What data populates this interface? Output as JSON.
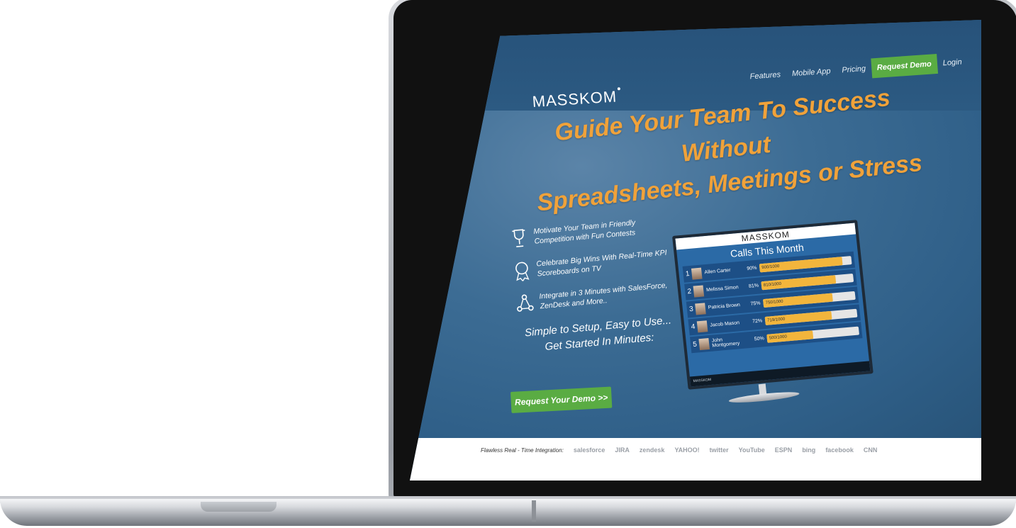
{
  "nav": {
    "brand": "MASSKOM",
    "items": [
      {
        "label": "Features",
        "cta": false
      },
      {
        "label": "Mobile App",
        "cta": false
      },
      {
        "label": "Pricing",
        "cta": false
      },
      {
        "label": "Request Demo",
        "cta": true
      },
      {
        "label": "Login",
        "cta": false
      }
    ]
  },
  "hero": {
    "headline_line1": "Guide Your Team To Success Without",
    "headline_line2": "Spreadsheets, Meetings or Stress",
    "features": [
      {
        "icon": "trophy-icon",
        "line1": "Motivate Your Team in Friendly",
        "line2": "Competition with Fun Contests"
      },
      {
        "icon": "award-ribbon-icon",
        "line1": "Celebrate Big Wins With Real-Time KPI",
        "line2": "Scoreboards on TV"
      },
      {
        "icon": "integration-network-icon",
        "line1": "Integrate in 3 Minutes with SalesForce,",
        "line2": "ZenDesk and More.."
      }
    ],
    "tagline_line1": "Simple to Setup, Easy to Use...",
    "tagline_line2": "Get Started In Minutes:",
    "demo_button": "Request Your Demo >>"
  },
  "leaderboard": {
    "brand": "MASSKOM",
    "title": "Calls This Month",
    "rows": [
      {
        "rank": "1",
        "name": "Allen Carter",
        "pct": "90%",
        "fill": 0.9,
        "count": "900/1000"
      },
      {
        "rank": "2",
        "name": "Melissa Simon",
        "pct": "81%",
        "fill": 0.81,
        "count": "810/1000"
      },
      {
        "rank": "3",
        "name": "Patricia Brown",
        "pct": "75%",
        "fill": 0.75,
        "count": "750/1000"
      },
      {
        "rank": "4",
        "name": "Jacob Mason",
        "pct": "72%",
        "fill": 0.72,
        "count": "719/1000"
      },
      {
        "rank": "5",
        "name": "John Montgomery",
        "pct": "50%",
        "fill": 0.5,
        "count": "500/1000"
      }
    ],
    "footer_brand": "MASSKOM"
  },
  "integrations": {
    "label": "Flawless Real - Time Integration:",
    "partners": [
      "salesforce",
      "JIRA",
      "zendesk",
      "YAHOO!",
      "twitter",
      "YouTube",
      "ESPN",
      "bing",
      "facebook",
      "CNN"
    ]
  },
  "colors": {
    "accent_orange": "#f0a23a",
    "cta_green": "#5aac43",
    "hero_blue": "#2f5f88"
  }
}
